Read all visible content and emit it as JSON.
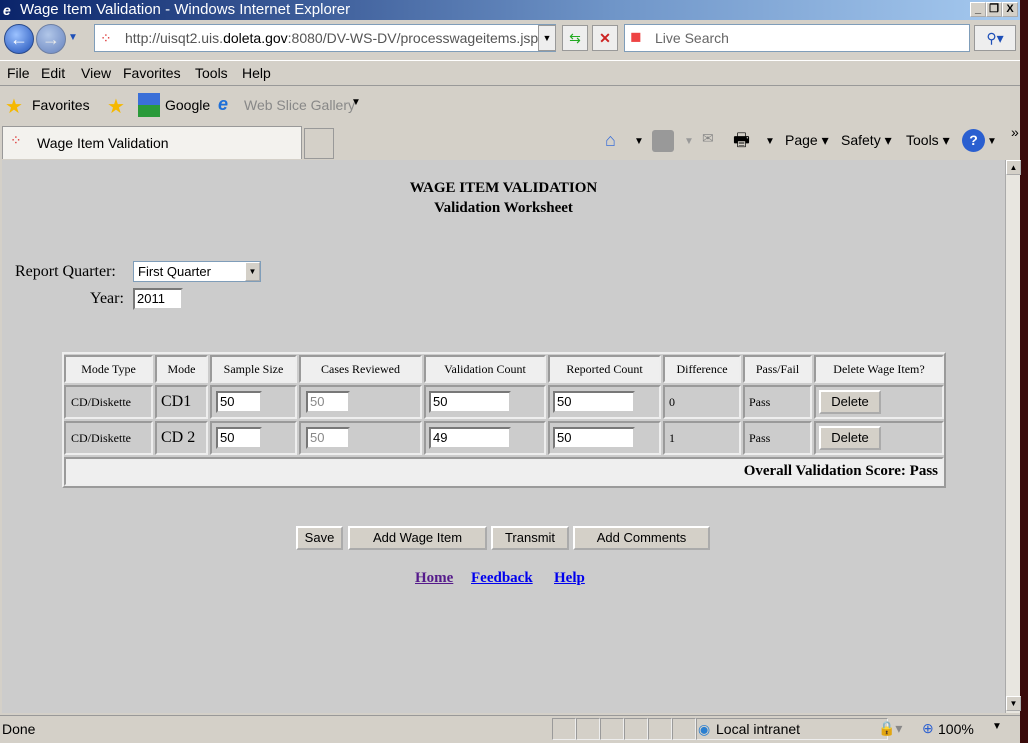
{
  "window": {
    "title": "Wage Item Validation - Windows Internet Explorer",
    "minimize": "_",
    "restore": "❐",
    "close": "X"
  },
  "address": {
    "prefix": "http://uisqt2.uis.",
    "domain": "doleta.gov",
    "suffix": ":8080/DV-WS-DV/processwageitems.jsp"
  },
  "search": {
    "placeholder": "Live Search"
  },
  "menu": [
    "File",
    "Edit",
    "View",
    "Favorites",
    "Tools",
    "Help"
  ],
  "favorites": {
    "label": "Favorites",
    "google": "Google",
    "webslice": "Web Slice Gallery"
  },
  "tab": {
    "title": "Wage Item Validation"
  },
  "commands": {
    "page": "Page ▾",
    "safety": "Safety ▾",
    "tools": "Tools ▾"
  },
  "page": {
    "title": "WAGE ITEM VALIDATION",
    "subtitle": "Validation Worksheet",
    "quarter_label": "Report Quarter:",
    "quarter_value": "First Quarter",
    "year_label": "Year:",
    "year_value": "2011"
  },
  "table": {
    "headers": [
      "Mode Type",
      "Mode",
      "Sample Size",
      "Cases Reviewed",
      "Validation Count",
      "Reported Count",
      "Difference",
      "Pass/Fail",
      "Delete Wage Item?"
    ],
    "rows": [
      {
        "mode_type": "CD/Diskette",
        "mode": "CD1",
        "sample": "50",
        "cases": "50",
        "validation": "50",
        "reported": "50",
        "difference": "0",
        "result": "Pass",
        "delete": "Delete"
      },
      {
        "mode_type": "CD/Diskette",
        "mode": "CD 2",
        "sample": "50",
        "cases": "50",
        "validation": "49",
        "reported": "50",
        "difference": "1",
        "result": "Pass",
        "delete": "Delete"
      }
    ],
    "overall": "Overall Validation Score: Pass"
  },
  "buttons": {
    "save": "Save",
    "add": "Add Wage Item",
    "transmit": "Transmit",
    "comments": "Add Comments"
  },
  "links": {
    "home": "Home",
    "feedback": "Feedback",
    "help": "Help"
  },
  "status": {
    "text": "Done",
    "zone": "Local intranet",
    "zoom": "100%"
  }
}
